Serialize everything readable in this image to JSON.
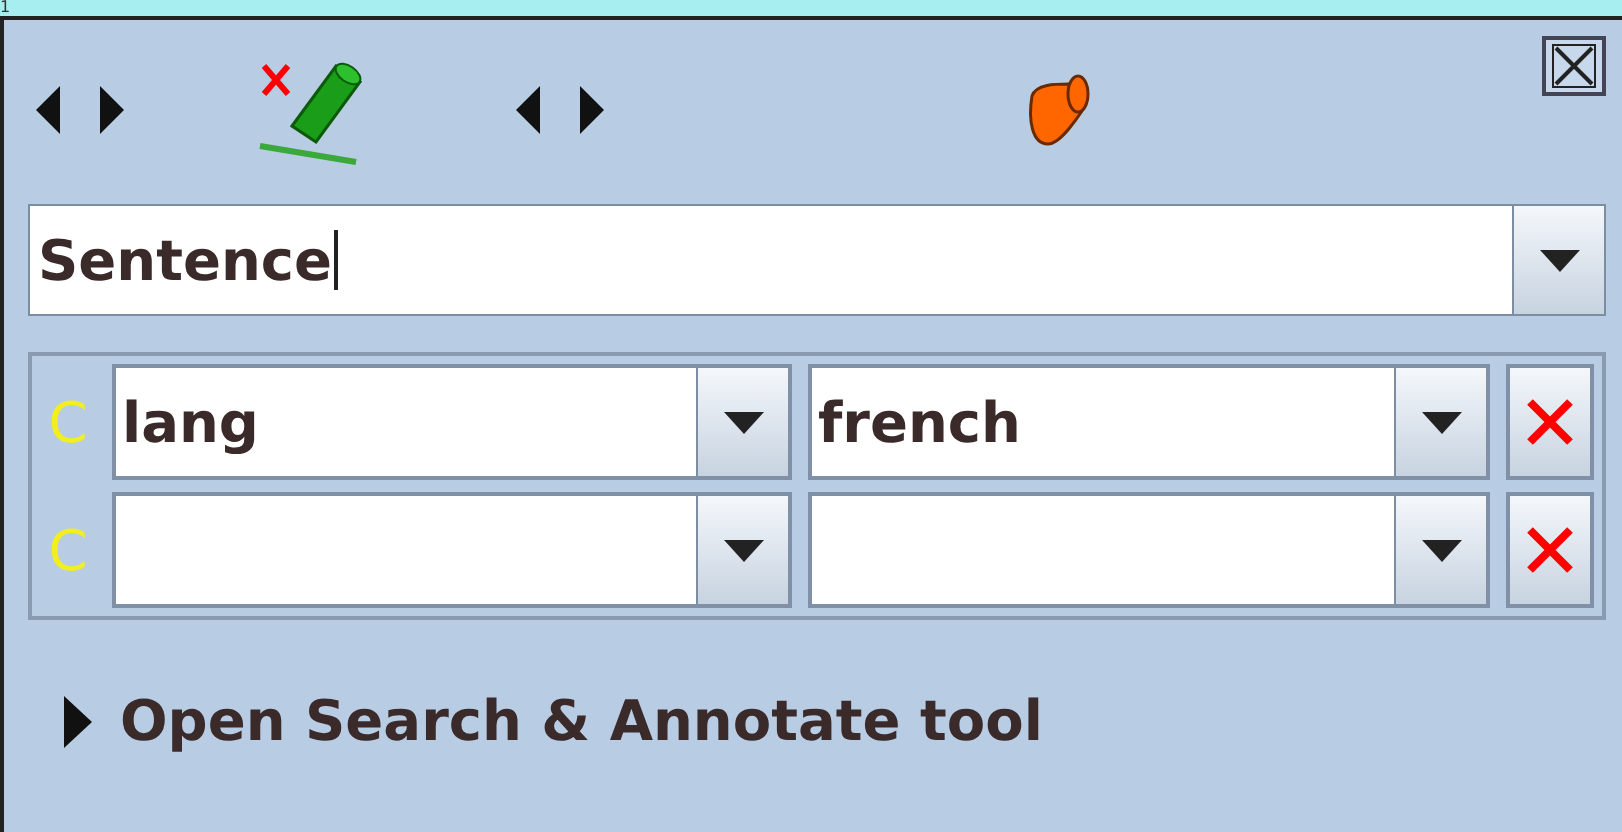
{
  "background": {
    "top_text": "1"
  },
  "annotation_type": {
    "value": "Sentence"
  },
  "constraints": [
    {
      "marker": "C",
      "key": "lang",
      "value": "french"
    },
    {
      "marker": "C"
    }
  ],
  "expander": {
    "label": "Open Search & Annotate tool",
    "expanded": false
  }
}
